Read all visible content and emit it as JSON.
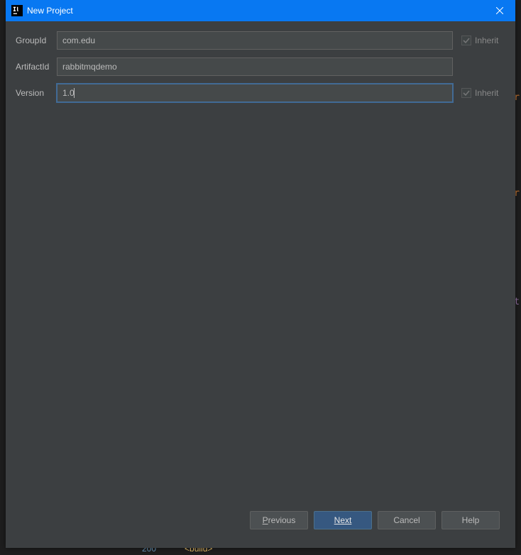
{
  "titlebar": {
    "title": "New Project"
  },
  "form": {
    "groupId": {
      "label": "GroupId",
      "value": "com.edu",
      "inherit_label": "Inherit",
      "inherit_checked": true
    },
    "artifactId": {
      "label": "ArtifactId",
      "value": "rabbitmqdemo"
    },
    "version": {
      "label": "Version",
      "value": "1.0",
      "inherit_label": "Inherit",
      "inherit_checked": true
    }
  },
  "buttons": {
    "previous": "Previous",
    "next": "Next",
    "cancel": "Cancel",
    "help": "Help"
  },
  "backdrop": {
    "code_bottom_num": "200",
    "code_bottom_tag": "<build>"
  }
}
